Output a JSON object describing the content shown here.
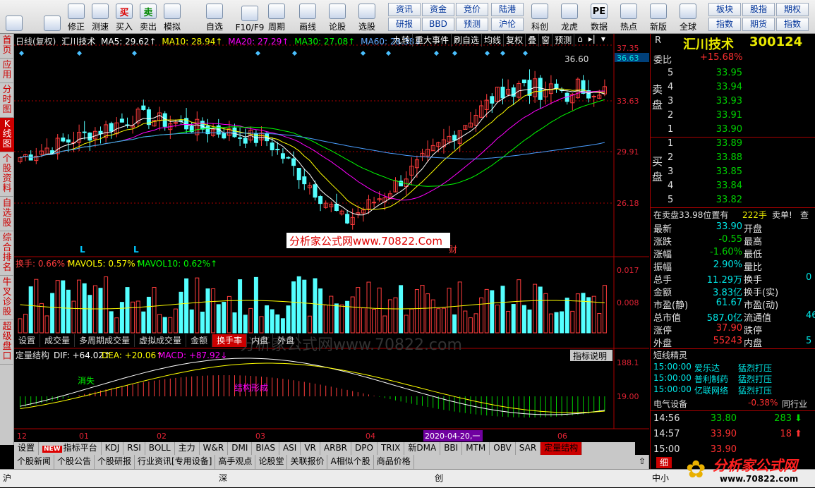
{
  "toolbar": {
    "buttons": [
      {
        "label": "",
        "icon": "grid-icon"
      },
      {
        "label": "",
        "icon": "back-arrow-icon"
      },
      {
        "label": "修正",
        "icon": "up-down-icon"
      },
      {
        "label": "测速",
        "icon": "clock-icon"
      },
      {
        "label": "买入",
        "icon": "buy-icon",
        "glyph": "买"
      },
      {
        "label": "卖出",
        "icon": "sell-icon",
        "glyph": "卖"
      },
      {
        "label": "模拟",
        "icon": "hammer-icon"
      },
      {
        "label": "自选",
        "icon": "star-icon"
      },
      {
        "label": "F10/F9",
        "icon": "window-icon"
      },
      {
        "label": "周期",
        "icon": "period-icon"
      },
      {
        "label": "画线",
        "icon": "pen-icon"
      },
      {
        "label": "论股",
        "icon": "discuss-icon"
      },
      {
        "label": "选股",
        "icon": "select-icon"
      }
    ],
    "grid1": [
      "资讯",
      "资金",
      "竞价",
      "研报",
      "BBD",
      "预测"
    ],
    "grid2": [
      "陆港",
      "沪伦"
    ],
    "buttons2": [
      {
        "label": "科创",
        "icon": "chart-icon"
      },
      {
        "label": "龙虎",
        "icon": "dragon-icon"
      },
      {
        "label": "数据",
        "icon": "pe-icon",
        "glyph": "PE"
      },
      {
        "label": "热点",
        "icon": "hot-icon"
      },
      {
        "label": "新版",
        "icon": "new-icon"
      },
      {
        "label": "全球",
        "icon": "globe-icon"
      }
    ],
    "grid3": [
      "板块",
      "股指",
      "期权",
      "指数",
      "期货",
      "指数"
    ]
  },
  "sidebar": [
    "首页",
    "应用",
    "分时图",
    "K线图",
    "个股资料",
    "自选股",
    "综合排名",
    "牛叉诊股",
    "超级盘口"
  ],
  "chart": {
    "kline_header": {
      "type": "日线(复权)",
      "name": "汇川技术",
      "ma5": "MA5: 29.62↑",
      "ma10": "MA10: 28.94↑",
      "ma20": "MA20: 27.29↑",
      "ma30": "MA30: 27.08↑",
      "ma60": "MA60: 28.38↓"
    },
    "top_menu": [
      "九转",
      "重大事件",
      "刷自选",
      "均线",
      "复权",
      "叠",
      "窗",
      "预测"
    ],
    "price_axis": [
      "37.35",
      "36.63",
      "33.63",
      "29.91",
      "26.18"
    ],
    "peak_label": "36.60",
    "marks": [
      "L",
      "L",
      "财"
    ],
    "watermark": "分析家公式网www.70822.Com",
    "vol_header": {
      "a": "换手: 0.66%↑",
      "b": "MAVOL5: 0.57%↑",
      "c": "MAVOL10: 0.62%↑"
    },
    "vol_axis": [
      "0.017",
      "0.008"
    ],
    "tabs": [
      "设置",
      "成交量",
      "多周期成交量",
      "虚拟成交量",
      "金额",
      "换手率",
      "内盘",
      "外盘"
    ],
    "macd_header": {
      "name": "定量结构",
      "dif": "DIF: +64.02↑",
      "dea": "DEA: +20.06↑",
      "macd": "MACD: +87.92↓"
    },
    "indicator_btn": "指标说明",
    "macd_axis": [
      "188.1",
      "19.00"
    ],
    "macd_labels": [
      "消失",
      "结构形成"
    ],
    "watermark2": "分析家公式网www.70822.com",
    "x_axis": [
      "12",
      "01",
      "02",
      "03",
      "04",
      "06"
    ],
    "x_highlight": "2020-04-20,一"
  },
  "indicator_tabs": [
    "设置",
    "指标平台",
    "KDJ",
    "RSI",
    "BOLL",
    "主力",
    "W&R",
    "DMI",
    "BIAS",
    "ASI",
    "VR",
    "ARBR",
    "DPO",
    "TRIX",
    "新DMA",
    "BBI",
    "MTM",
    "OBV",
    "SAR",
    "定量结构"
  ],
  "new_badge": "NEW",
  "news_tabs": [
    "个股新闻",
    "个股公告",
    "个股研报",
    "行业资讯[专用设备]",
    "高手观点",
    "论股堂",
    "关联报价",
    "A相似个股",
    "商品价格"
  ],
  "quote": {
    "code_flag": "R",
    "name": "汇川技术",
    "code": "300124",
    "weibi_label": "委比",
    "weibi": "+15.68%",
    "sell_label": "卖盘",
    "sell": [
      [
        "5",
        "33.95"
      ],
      [
        "4",
        "33.94"
      ],
      [
        "3",
        "33.93"
      ],
      [
        "2",
        "33.91"
      ],
      [
        "1",
        "33.90"
      ]
    ],
    "buy_label": "买盘",
    "buy": [
      [
        "1",
        "33.89"
      ],
      [
        "2",
        "33.88"
      ],
      [
        "3",
        "33.85"
      ],
      [
        "4",
        "33.84"
      ],
      [
        "5",
        "33.82"
      ]
    ],
    "notice": "在卖盘33.98位置有",
    "notice_vol": "222手",
    "notice_tail": "卖单!",
    "notice_btn": "查",
    "stats": [
      [
        "最新",
        "33.90",
        "开盘",
        ""
      ],
      [
        "涨跌",
        "-0.55",
        "最高",
        ""
      ],
      [
        "涨幅",
        "-1.60%",
        "最低",
        ""
      ],
      [
        "振幅",
        "2.90%",
        "量比",
        ""
      ],
      [
        "总手",
        "11.29万",
        "换手",
        "0"
      ],
      [
        "金额",
        "3.83亿",
        "换手(实)",
        ""
      ],
      [
        "市盈(静)",
        "61.67",
        "市盈(动)",
        ""
      ],
      [
        "总市值",
        "587.0亿",
        "流通值",
        "46"
      ],
      [
        "涨停",
        "37.90",
        "跌停",
        ""
      ],
      [
        "外盘",
        "55243",
        "内盘",
        "5"
      ]
    ],
    "sprite_title": "短线精灵",
    "sprite": [
      [
        "15:00:00",
        "爱乐达",
        "猛烈打压"
      ],
      [
        "15:00:00",
        "普利制药",
        "猛烈打压"
      ],
      [
        "15:00:00",
        "亿联网络",
        "猛烈打压"
      ]
    ],
    "sector": "电气设备",
    "sector_chg": "-0.38%",
    "sector_btn": "同行业",
    "ticks": [
      [
        "14:56",
        "33.80",
        "283"
      ],
      [
        "14:57",
        "33.90",
        "18"
      ],
      [
        "15:00",
        "33.90",
        ""
      ]
    ],
    "detail_tab": "细"
  },
  "status": {
    "sh": "沪",
    "sz": "深",
    "cy": "创",
    "zx": "中小",
    "logo": "分析家公式网",
    "logo_url": "www.70822.com"
  }
}
